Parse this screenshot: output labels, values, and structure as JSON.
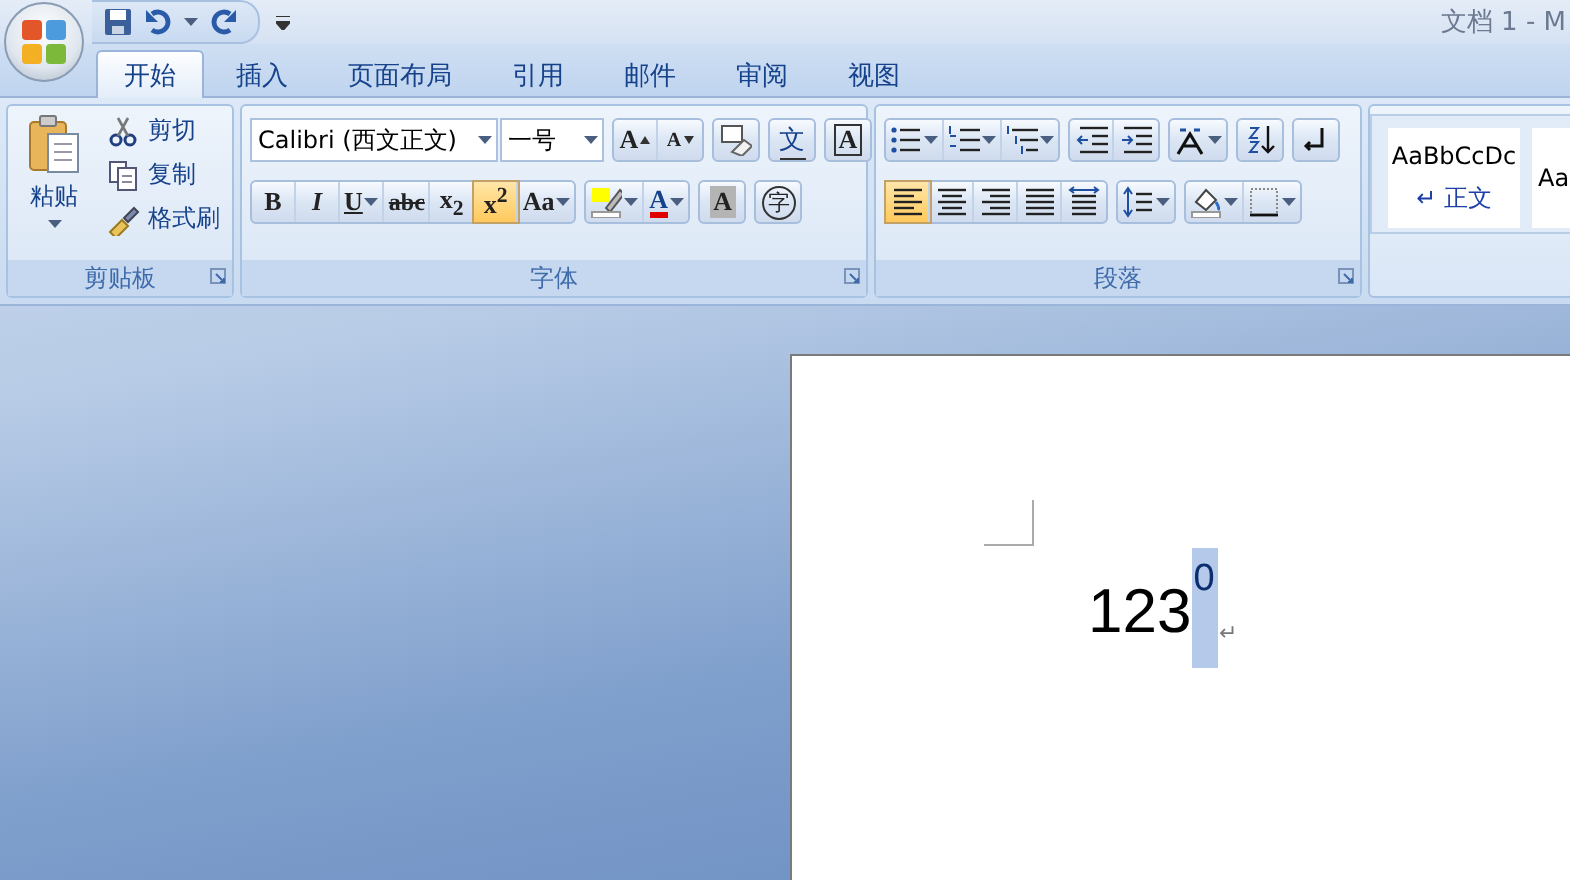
{
  "window": {
    "title": "文档 1 - M"
  },
  "tabs": [
    {
      "label": "开始",
      "selected": true
    },
    {
      "label": "插入",
      "selected": false
    },
    {
      "label": "页面布局",
      "selected": false
    },
    {
      "label": "引用",
      "selected": false
    },
    {
      "label": "邮件",
      "selected": false
    },
    {
      "label": "审阅",
      "selected": false
    },
    {
      "label": "视图",
      "selected": false
    }
  ],
  "clipboard": {
    "label": "剪贴板",
    "paste": "粘贴",
    "items": [
      {
        "kind": "cut",
        "label": "剪切"
      },
      {
        "kind": "copy",
        "label": "复制"
      },
      {
        "kind": "format-painter",
        "label": "格式刷"
      }
    ]
  },
  "font": {
    "label": "字体",
    "font_name": "Calibri (西文正文)",
    "font_size": "一号",
    "row_1": [
      [
        {
          "kind": "grow",
          "glyph": "A",
          "active": false
        },
        {
          "kind": "shrink",
          "glyph": "A",
          "active": false
        }
      ],
      [
        {
          "kind": "clear",
          "active": false
        }
      ],
      [
        {
          "kind": "phonetic",
          "glyph": "文",
          "active": false
        }
      ],
      [
        {
          "kind": "char-border",
          "glyph": "A",
          "active": false
        }
      ]
    ],
    "row_2": [
      [
        {
          "kind": "bold",
          "glyph": "B",
          "active": false
        },
        {
          "kind": "italic",
          "glyph": "I",
          "active": false
        },
        {
          "kind": "underline",
          "glyph": "U",
          "dropdown": true,
          "active": false
        },
        {
          "kind": "strike",
          "glyph": "abc",
          "active": false
        },
        {
          "kind": "subscript",
          "glyph": "x$_{2}$",
          "active": false
        },
        {
          "kind": "superscript",
          "glyph": "x$^{2}$",
          "active": true
        },
        {
          "kind": "case",
          "glyph": "Aa",
          "dropdown": true,
          "active": false
        }
      ],
      [
        {
          "kind": "highlight",
          "dropdown": true,
          "active": false
        },
        {
          "kind": "font-color",
          "glyph": "A",
          "dropdown": true,
          "active": false
        }
      ],
      [
        {
          "kind": "char-shading",
          "glyph": "A",
          "active": false
        }
      ],
      [
        {
          "kind": "enclose",
          "glyph": "字",
          "active": false
        }
      ]
    ]
  },
  "paragraph": {
    "label": "段落",
    "row_1": [
      [
        {
          "kind": "bullets",
          "dropdown": true,
          "active": false
        },
        {
          "kind": "numbering",
          "dropdown": true,
          "active": false
        },
        {
          "kind": "multilevel",
          "dropdown": true,
          "active": false
        }
      ],
      [
        {
          "kind": "outdent",
          "active": false
        },
        {
          "kind": "indent",
          "active": false
        }
      ],
      [
        {
          "kind": "asian-layout",
          "dropdown": true,
          "active": false
        }
      ],
      [
        {
          "kind": "sort",
          "active": false
        }
      ],
      [
        {
          "kind": "show-marks",
          "active": false
        }
      ]
    ],
    "row_2": [
      [
        {
          "kind": "align-left",
          "active": true
        },
        {
          "kind": "center",
          "active": false
        },
        {
          "kind": "align-right",
          "active": false
        },
        {
          "kind": "justify",
          "active": false
        },
        {
          "kind": "distribute",
          "active": false
        }
      ],
      [
        {
          "kind": "line-spacing",
          "dropdown": true,
          "active": false
        }
      ],
      [
        {
          "kind": "shading",
          "dropdown": true,
          "active": false
        },
        {
          "kind": "borders",
          "dropdown": true,
          "active": false
        }
      ]
    ]
  },
  "styles": [
    {
      "preview": "AaBbCcDc",
      "name": "↵ 正文"
    },
    {
      "preview": "Aa"
    }
  ],
  "document": {
    "text": "123",
    "superscript": "0",
    "superscript_selected": true,
    "paragraph_mark": "↵"
  }
}
